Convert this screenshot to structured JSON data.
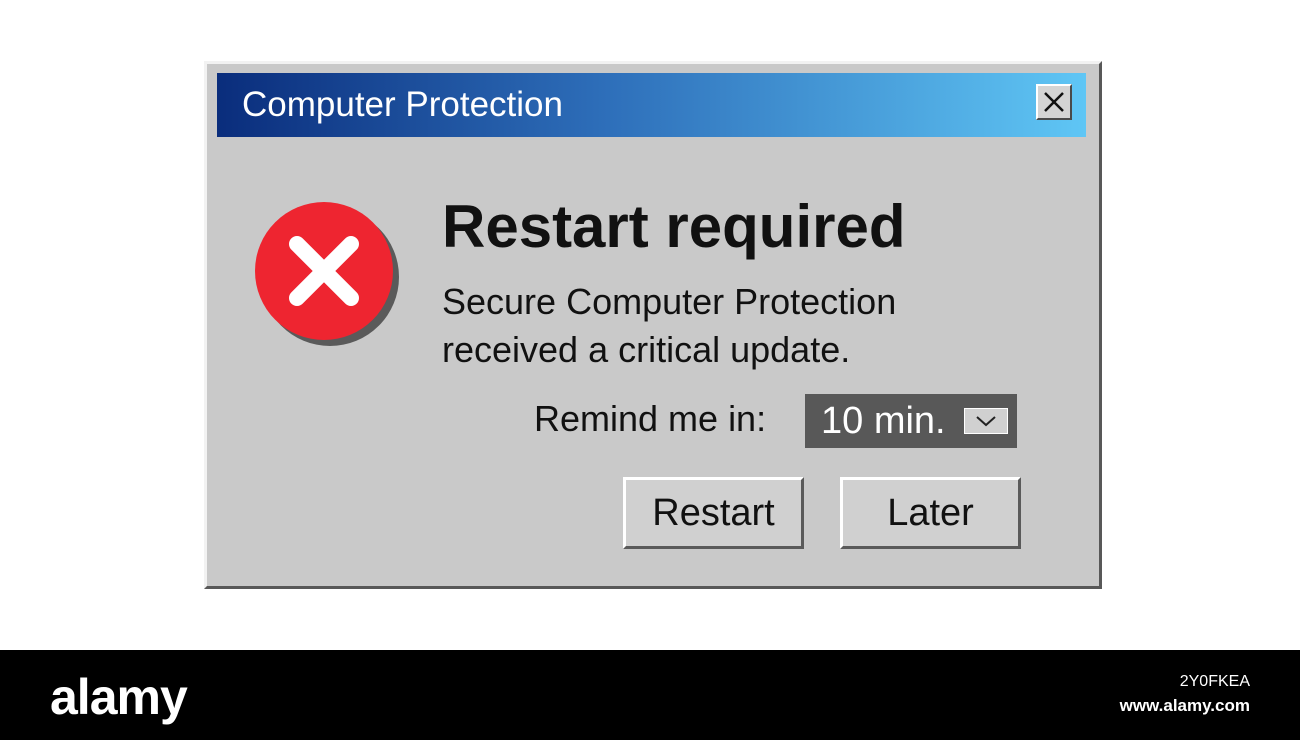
{
  "dialog": {
    "title": "Computer Protection",
    "close_icon": "close-icon",
    "status_icon": "error-icon",
    "headline": "Restart required",
    "message_line1": "Secure Computer Protection",
    "message_line2": "received a critical update.",
    "remind_label": "Remind me in:",
    "remind_value": "10 min.",
    "dropdown_icon": "chevron-down-icon",
    "restart_label": "Restart",
    "later_label": "Later"
  },
  "colors": {
    "titlebar_start": "#0a2d7c",
    "titlebar_end": "#5fc6f5",
    "dialog_bg": "#c9c9c9",
    "error_red": "#ee2530"
  },
  "footer": {
    "logo": "alamy",
    "image_id": "2Y0FKEA",
    "url": "www.alamy.com"
  }
}
